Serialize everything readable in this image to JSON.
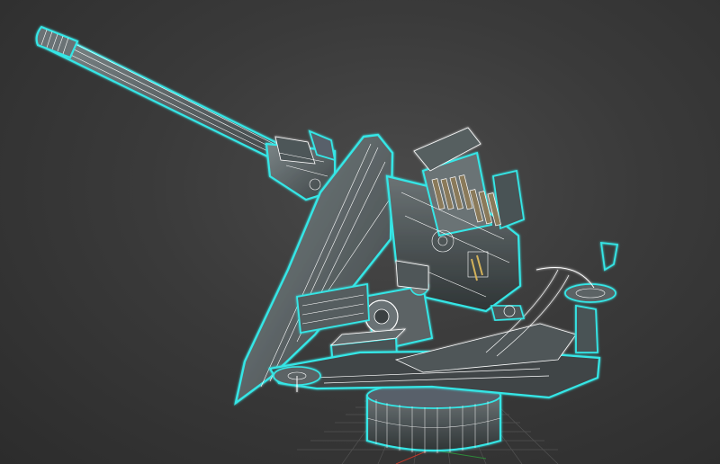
{
  "viewport": {
    "background_color": "#3a3a3a",
    "wire_color": "#ffffff",
    "selection_outline_color": "#35e6e6",
    "mesh_fill_color": "#5e6668",
    "grid_color": "#6a6a6a",
    "axis_red": "#c0392b",
    "axis_green": "#2e8b3a",
    "model_object": "anti-aircraft-gun-wireframe",
    "shading_mode": "wireframe-over-shaded",
    "selected": true
  }
}
